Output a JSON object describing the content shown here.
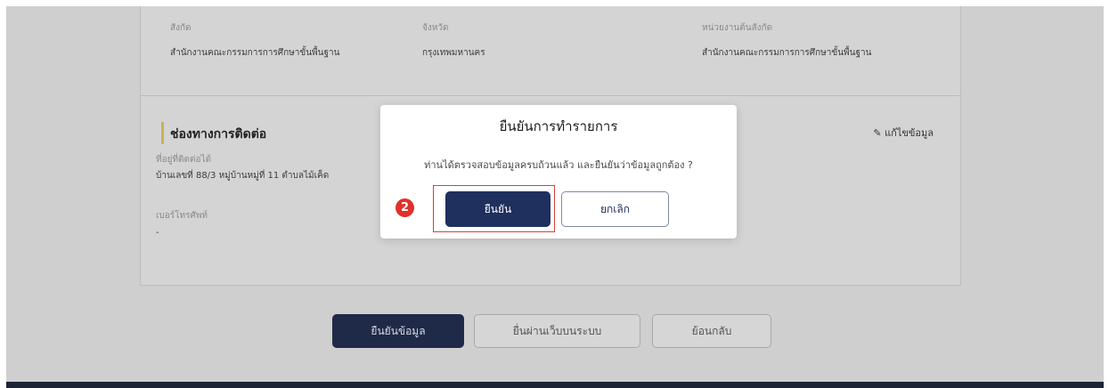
{
  "colors": {
    "overlay_bg": "#cfcfcf",
    "primary": "#1f2f5e",
    "accent": "#c9b25a",
    "highlight": "#d9403a"
  },
  "info_row": [
    {
      "label": "สังกัด",
      "value": "สำนักงานคณะกรรมการการศึกษาขั้นพื้นฐาน"
    },
    {
      "label": "จังหวัด",
      "value": "กรุงเทพมหานคร"
    },
    {
      "label": "หน่วยงานต้นสังกัด",
      "value": "สำนักงานคณะกรรมการการศึกษาขั้นพื้นฐาน"
    }
  ],
  "contact": {
    "title": "ช่องทางการติดต่อ",
    "edit_label": "แก้ไขข้อมูล",
    "address_label": "ที่อยู่ที่ติดต่อได้",
    "address_value": "บ้านเลขที่ 88/3 หมู่บ้านหมู่ที่ 11 ตำบลไม้เค็ด",
    "phone_label": "เบอร์โทรศัพท์",
    "phone_value": "-"
  },
  "bottom_buttons": {
    "confirm": "ยืนยันข้อมูล",
    "history": "ยื่นผ่านเว็บบนระบบ",
    "back": "ย้อนกลับ"
  },
  "modal": {
    "title": "ยืนยันการทำรายการ",
    "message": "ท่านได้ตรวจสอบข้อมูลครบถ้วนแล้ว และยืนยันว่าข้อมูลถูกต้อง ?",
    "confirm_label": "ยืนยัน",
    "cancel_label": "ยกเลิก",
    "step": "2"
  }
}
